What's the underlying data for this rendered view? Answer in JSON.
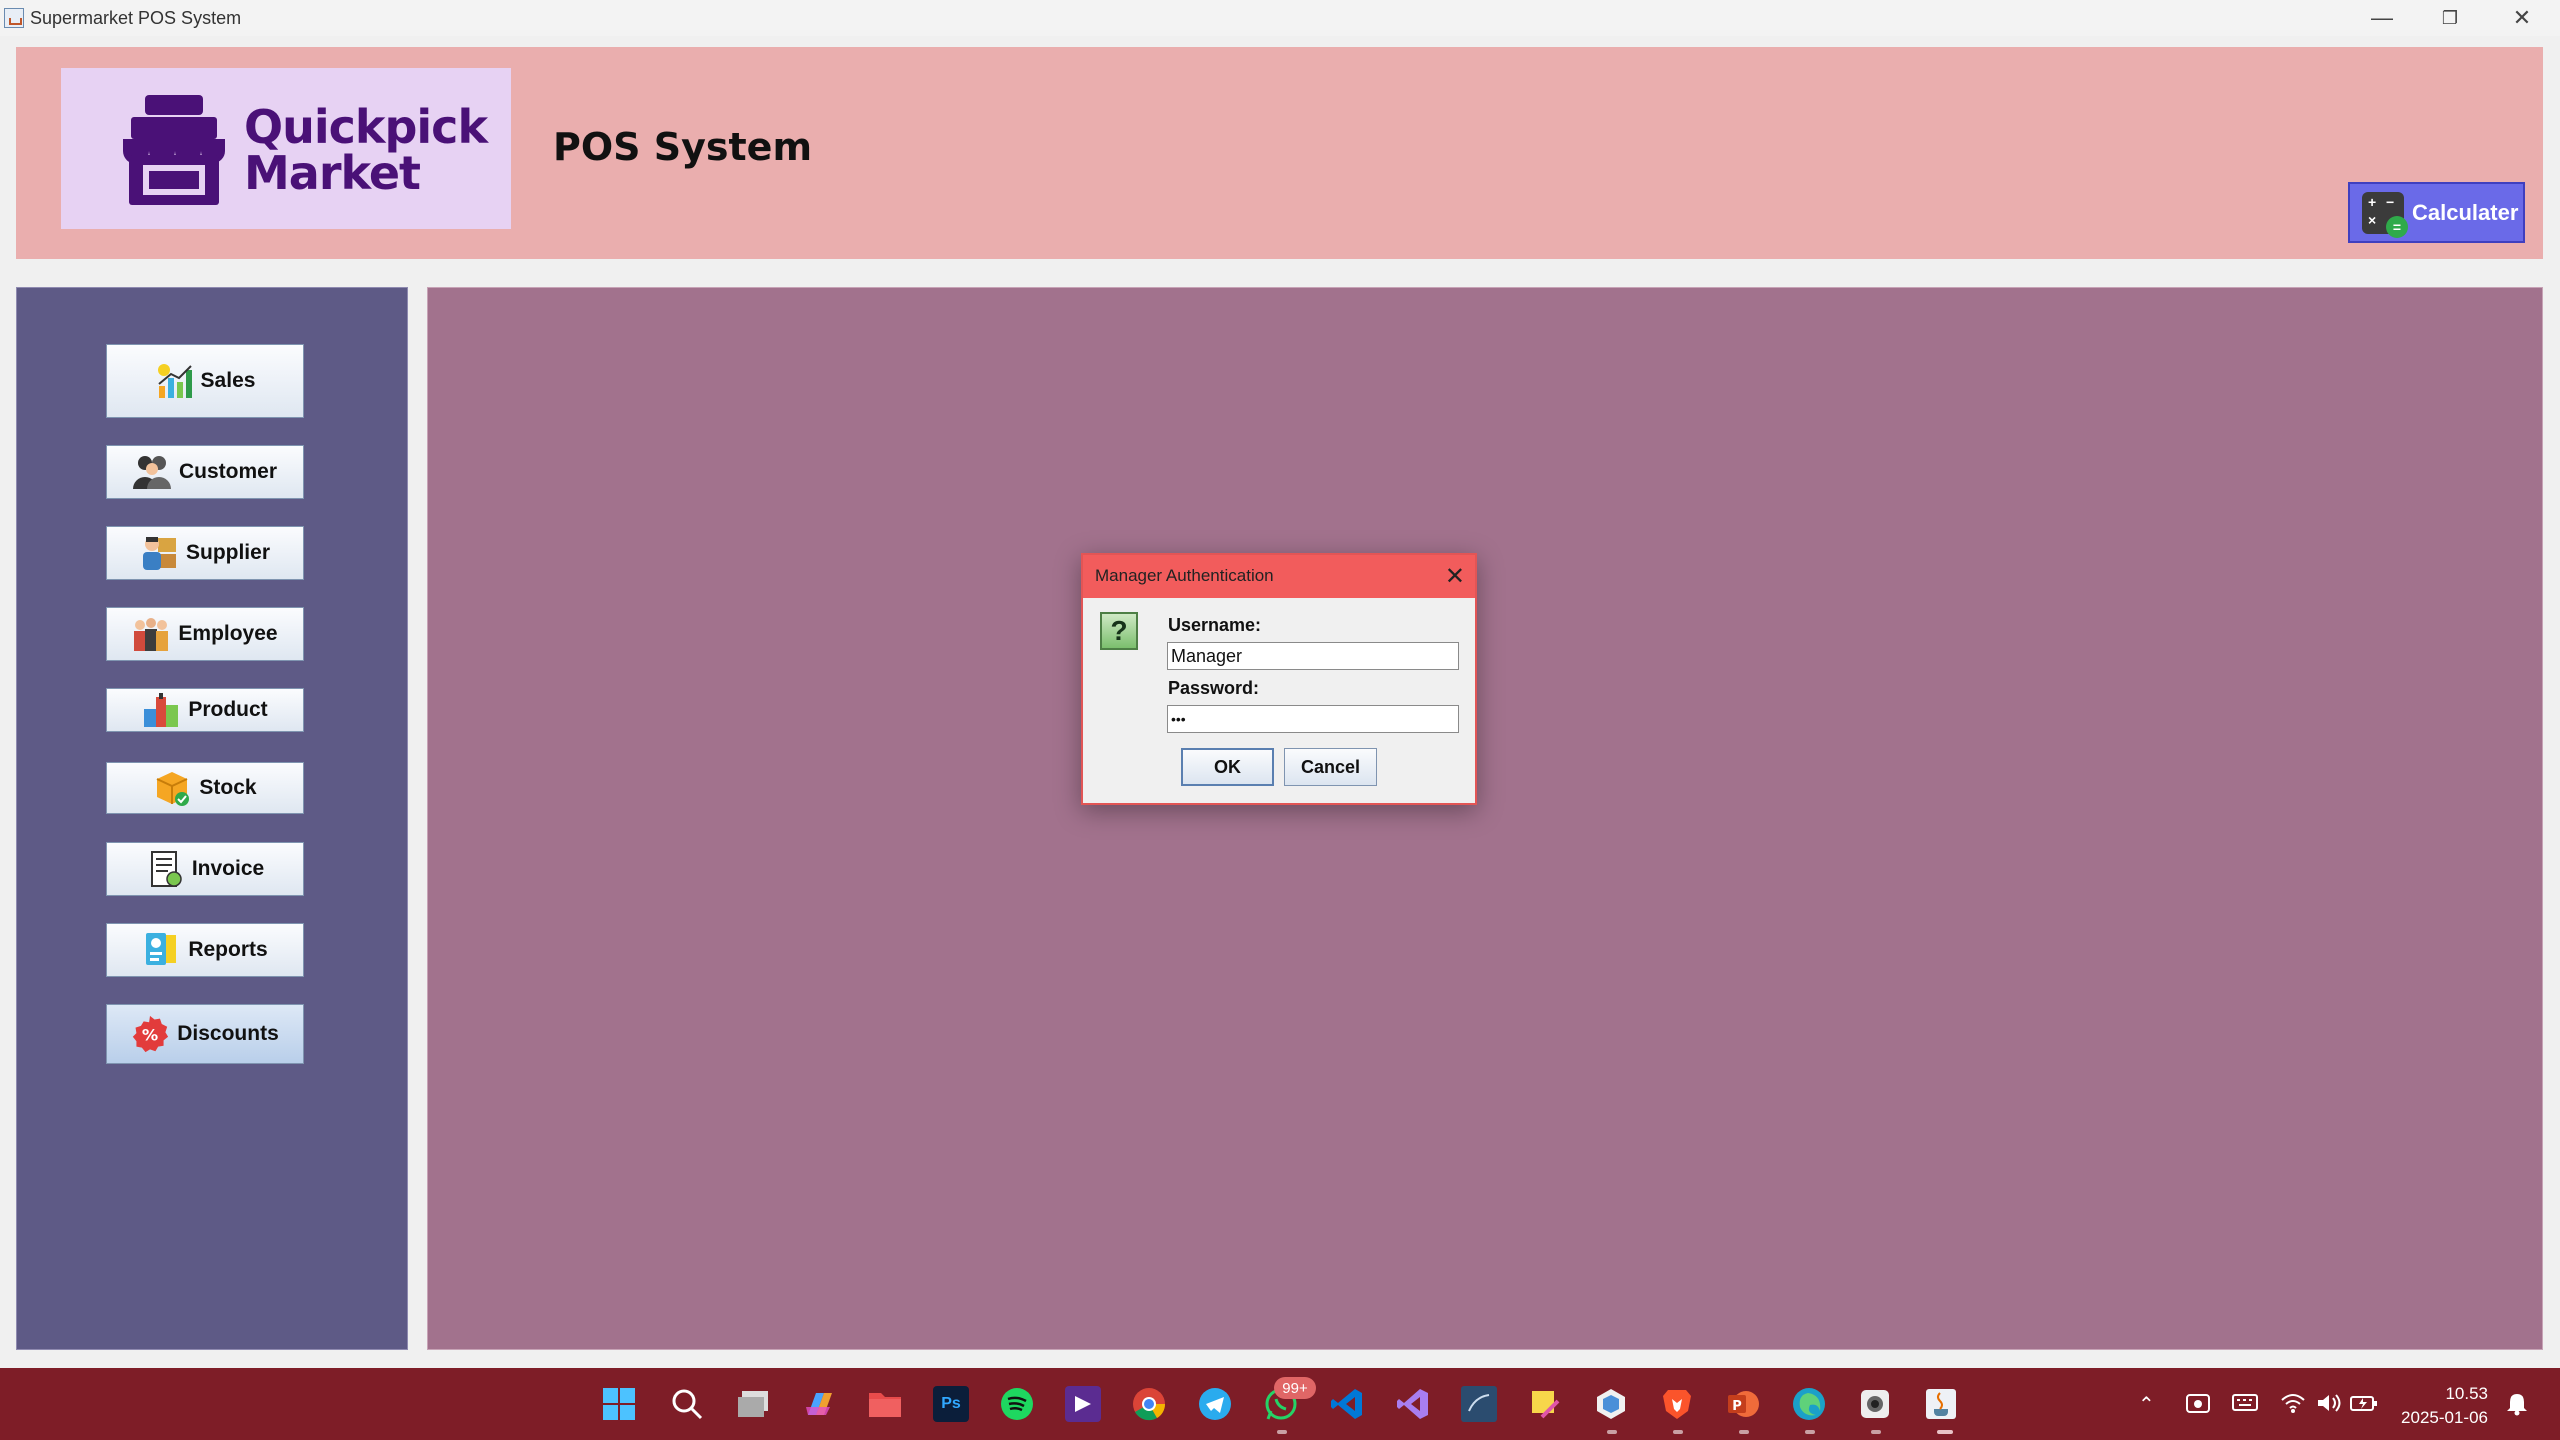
{
  "window": {
    "title": "Supermarket POS System",
    "minimize": "—",
    "restore": "❐",
    "close": "✕"
  },
  "header": {
    "logo_text": "Quickpick Market",
    "logo_line1": "Quickpick",
    "logo_line2": "Market",
    "system_title": "POS System",
    "calculator_label": "Calculater"
  },
  "sidebar": {
    "items": [
      {
        "label": "Sales",
        "icon": "sales-chart-icon"
      },
      {
        "label": "Customer",
        "icon": "customer-icon"
      },
      {
        "label": "Supplier",
        "icon": "supplier-icon"
      },
      {
        "label": "Employee",
        "icon": "employee-icon"
      },
      {
        "label": "Product",
        "icon": "product-icon"
      },
      {
        "label": "Stock",
        "icon": "stock-box-icon"
      },
      {
        "label": "Invoice",
        "icon": "invoice-icon"
      },
      {
        "label": "Reports",
        "icon": "reports-icon"
      },
      {
        "label": "Discounts",
        "icon": "discount-icon"
      }
    ]
  },
  "dialog": {
    "title": "Manager Authentication",
    "icon": "question-icon",
    "icon_glyph": "?",
    "username_label": "Username:",
    "username_value": "Manager",
    "password_label": "Password:",
    "password_value": "•••",
    "ok_label": "OK",
    "cancel_label": "Cancel"
  },
  "taskbar": {
    "whatsapp_badge": "99+",
    "clock_time": "10.53",
    "clock_date": "2025-01-06"
  },
  "colors": {
    "header_bg": "#eaaeae",
    "logo_bg": "#e7d2f3",
    "brand_purple": "#4a1177",
    "sidebar_bg": "#5e5a86",
    "content_bg": "#a2728d",
    "dialog_title_bg": "#f25c5c",
    "calculator_bg": "#6a6ae8",
    "taskbar_bg": "#7e1d27"
  }
}
